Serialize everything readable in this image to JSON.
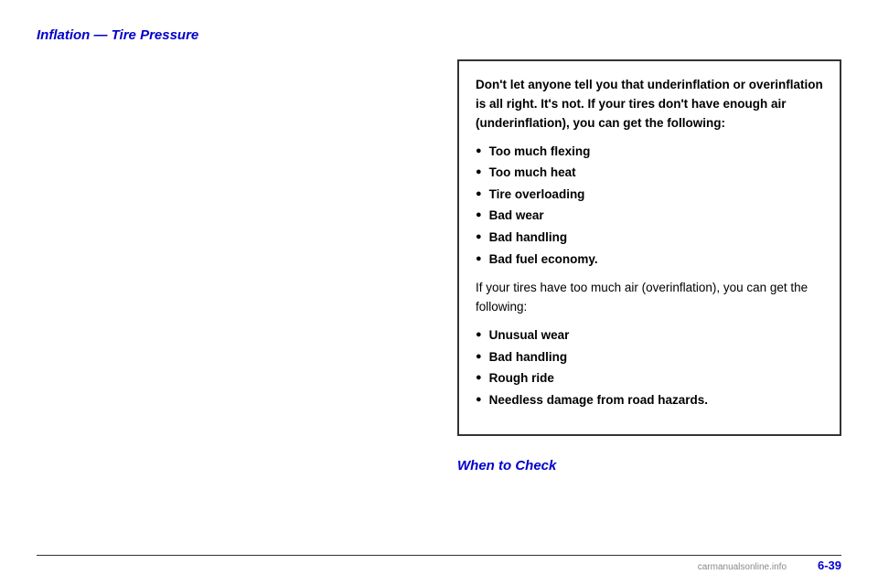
{
  "page": {
    "title": "Inflation — Tire Pressure",
    "background_color": "#ffffff"
  },
  "left_column": {
    "paragraphs": [
      "",
      "",
      ""
    ]
  },
  "warning_box": {
    "intro_text": "Don't let anyone tell you that underinflation or overinflation is all right. It's not. If your tires don't have enough air (underinflation), you can get the following:",
    "underinflation_items": [
      "Too much flexing",
      "Too much heat",
      "Tire overloading",
      "Bad wear",
      "Bad handling",
      "Bad fuel economy."
    ],
    "overinflation_intro": "If your tires have too much air (overinflation), you can get the following:",
    "overinflation_items": [
      "Unusual wear",
      "Bad handling",
      "Rough ride",
      "Needless damage from road hazards."
    ]
  },
  "when_to_check": {
    "label": "When to Check"
  },
  "footer": {
    "page_number": "6-39",
    "watermark": "carmanualsonline.info"
  }
}
